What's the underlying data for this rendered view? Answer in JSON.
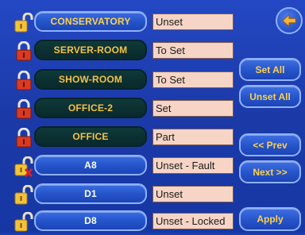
{
  "zones": [
    {
      "name": "CONSERVATORY",
      "status": "Unset",
      "state": "unset",
      "lock": "open"
    },
    {
      "name": "SERVER-ROOM",
      "status": "To Set",
      "state": "set",
      "lock": "closed"
    },
    {
      "name": "SHOW-ROOM",
      "status": "To Set",
      "state": "set",
      "lock": "closed"
    },
    {
      "name": "OFFICE-2",
      "status": "Set",
      "state": "set",
      "lock": "closed"
    },
    {
      "name": "OFFICE",
      "status": "Part",
      "state": "set",
      "lock": "closed"
    },
    {
      "name": "A8",
      "status": "Unset - Fault",
      "state": "unset",
      "lock": "open-fault"
    },
    {
      "name": "D1",
      "status": "Unset",
      "state": "unset",
      "lock": "open"
    },
    {
      "name": "D8",
      "status": "Unset - Locked",
      "state": "unset",
      "lock": "open"
    }
  ],
  "side_buttons": {
    "set_all": "Set All",
    "unset_all": "Unset All",
    "prev": "<< Prev",
    "next": "Next >>",
    "apply": "Apply"
  },
  "icons": {
    "back": "back-arrow-icon",
    "open_lock": "open-padlock-icon",
    "closed_lock": "closed-padlock-icon",
    "fault": "fault-x-icon"
  },
  "colors": {
    "background": "#1b3aa8",
    "button_blue": "#2654c9",
    "button_dark": "#0b2f31",
    "label_gold": "#f5c246",
    "status_field": "#f6d5c6",
    "lock_open": "#f2c33a",
    "lock_closed": "#d83a22",
    "fault_red": "#e02020"
  }
}
